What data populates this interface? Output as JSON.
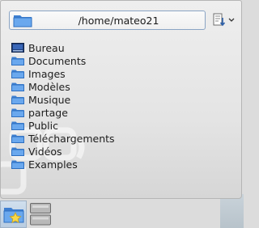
{
  "path_bar": {
    "path": "/home/mateo21",
    "icon": "folder-icon"
  },
  "sort_button": {
    "icon": "sort-descending-icon",
    "dropdown_icon": "chevron-down-icon"
  },
  "files": [
    {
      "name": "Bureau",
      "icon": "desktop-folder-icon"
    },
    {
      "name": "Documents",
      "icon": "folder-icon"
    },
    {
      "name": "Images",
      "icon": "folder-icon"
    },
    {
      "name": "Modèles",
      "icon": "folder-icon"
    },
    {
      "name": "Musique",
      "icon": "folder-icon"
    },
    {
      "name": "partage",
      "icon": "folder-icon"
    },
    {
      "name": "Public",
      "icon": "folder-icon"
    },
    {
      "name": "Téléchargements",
      "icon": "folder-icon"
    },
    {
      "name": "Vidéos",
      "icon": "folder-icon"
    },
    {
      "name": "Examples",
      "icon": "folder-icon"
    }
  ],
  "tabs": [
    {
      "icon": "folder-favorites-icon",
      "active": true
    },
    {
      "icon": "drives-icon",
      "active": false
    }
  ],
  "colors": {
    "folder": "#5b9be6",
    "accent_border": "#8aa4c4",
    "active_tab": "#c5d7ea"
  }
}
